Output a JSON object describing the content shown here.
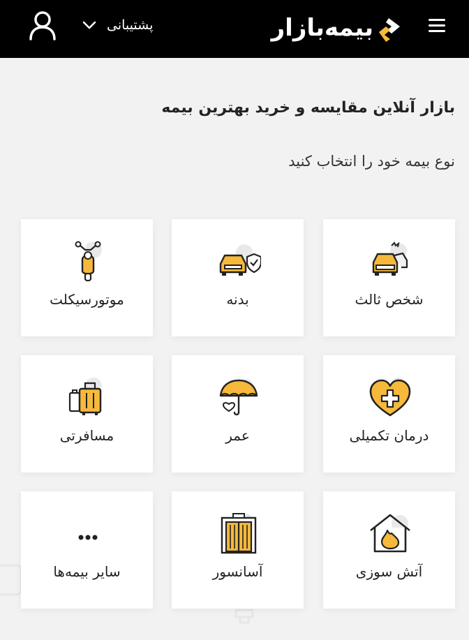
{
  "header": {
    "logo_text": "بیمه‌بازار",
    "support_label": "پشتیبانی"
  },
  "main": {
    "headline": "بازار آنلاین مقایسه و خرید بهترین بیمه",
    "subline": "نوع بیمه خود را انتخاب کنید"
  },
  "cards": [
    {
      "label": "شخص ثالث",
      "icon": "third-party-car-icon"
    },
    {
      "label": "بدنه",
      "icon": "car-body-shield-icon"
    },
    {
      "label": "موتورسیکلت",
      "icon": "motorcycle-icon"
    },
    {
      "label": "درمان تکمیلی",
      "icon": "heart-medical-icon"
    },
    {
      "label": "عمر",
      "icon": "umbrella-heart-icon"
    },
    {
      "label": "مسافرتی",
      "icon": "luggage-icon"
    },
    {
      "label": "آتش سوزی",
      "icon": "house-fire-icon"
    },
    {
      "label": "آسانسور",
      "icon": "elevator-icon"
    },
    {
      "label": "سایر بیمه‌ها",
      "icon": "more-dots-icon"
    }
  ],
  "colors": {
    "accent": "#f6b93b",
    "header_bg": "#000000",
    "page_bg": "#f2f2f2"
  }
}
